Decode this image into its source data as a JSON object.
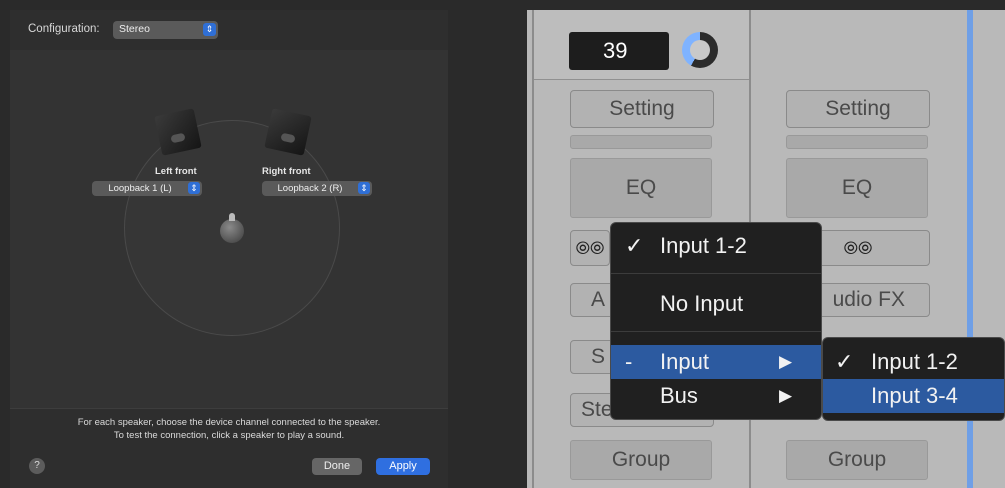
{
  "left_panel": {
    "configuration_label": "Configuration:",
    "configuration_value": "Stereo",
    "speakers": [
      {
        "label": "Left front",
        "channel": "Loopback 1 (L)"
      },
      {
        "label": "Right front",
        "channel": "Loopback 2 (R)"
      }
    ],
    "info_line1": "For each speaker, choose the device channel connected to the speaker.",
    "info_line2": "To test the connection, click a speaker to play a sound.",
    "help_label": "?",
    "done_label": "Done",
    "apply_label": "Apply",
    "colors": {
      "accent": "#2f6fe0",
      "panel": "#323232"
    }
  },
  "right_panel": {
    "counter_value": "39",
    "strip1": {
      "setting": "Setting",
      "eq": "EQ",
      "audio_fx": "A",
      "send": "S",
      "stereo_out": "Stereo Out",
      "group": "Group"
    },
    "strip2": {
      "setting": "Setting",
      "eq": "EQ",
      "audio_fx": "udio FX",
      "group": "Group"
    },
    "menu": {
      "items": [
        {
          "check": "✓",
          "label": "Input 1-2"
        },
        {
          "check": "",
          "label": "No Input"
        },
        {
          "check": "-",
          "label": "Input",
          "submenu": "▶"
        },
        {
          "check": "",
          "label": "Bus",
          "submenu": "▶"
        }
      ]
    },
    "submenu": {
      "items": [
        {
          "check": "✓",
          "label": "Input 1-2"
        },
        {
          "check": "",
          "label": "Input 3-4"
        }
      ]
    },
    "colors": {
      "highlight": "#2c5aa0",
      "menu_bg": "#202020",
      "strip_bg": "#b9b9b9"
    }
  }
}
